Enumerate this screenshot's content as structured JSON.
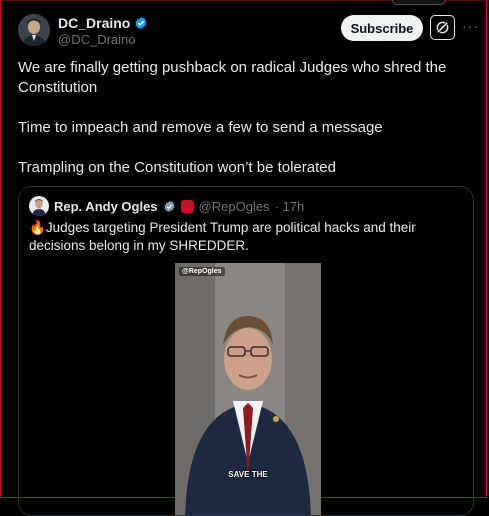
{
  "author": {
    "name": "DC_Draino",
    "handle": "@DC_Draino",
    "verified_icon": "verified-badge-icon"
  },
  "header": {
    "subscribe_label": "Subscribe",
    "grok_icon": "grok-icon",
    "more_icon": "more-icon",
    "more_label": "···"
  },
  "tweet": {
    "lines": [
      "We are finally getting pushback on radical Judges who shred the Constitution",
      "Time to impeach and remove a few to send a message",
      "Trampling on the Constitution won’t be tolerated"
    ]
  },
  "quote": {
    "name": "Rep. Andy Ogles",
    "handle": "@RepOgles",
    "time": "· 17h",
    "emoji": "🔥",
    "text": "Judges targeting President Trump are political hacks and their decisions belong in my SHREDDER.",
    "video": {
      "tag": "@RepOgles",
      "caption": "SAVE THE"
    }
  },
  "colors": {
    "background": "#000000",
    "text": "#e7e9ea",
    "secondary": "#71767b",
    "verified": "#1d9bf0",
    "border": "#2f3336",
    "subscribe_bg": "#eff3f4"
  }
}
